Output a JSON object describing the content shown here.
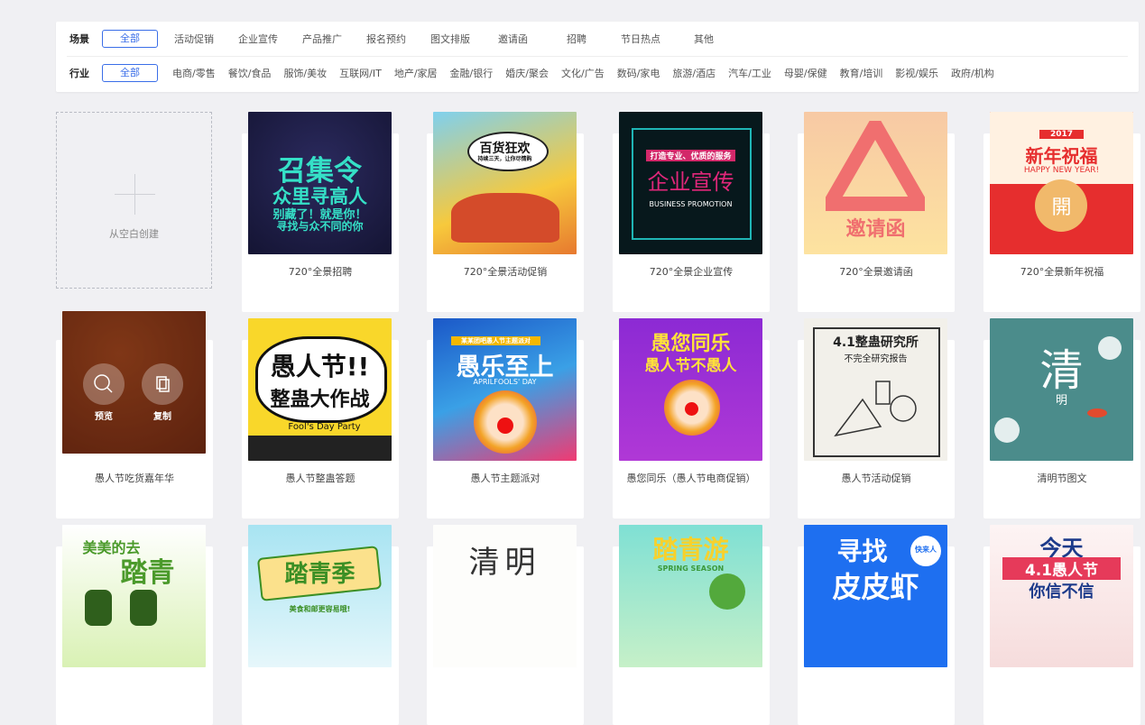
{
  "filters": {
    "scene_label": "场景",
    "scene_options": [
      "全部",
      "活动促销",
      "企业宣传",
      "产品推广",
      "报名预约",
      "图文排版",
      "邀请函",
      "招聘",
      "节日热点",
      "其他"
    ],
    "industry_label": "行业",
    "industry_options": [
      "全部",
      "电商/零售",
      "餐饮/食品",
      "服饰/美妆",
      "互联网/IT",
      "地产/家居",
      "金融/银行",
      "婚庆/聚会",
      "文化/广告",
      "数码/家电",
      "旅游/酒店",
      "汽车/工业",
      "母婴/保健",
      "教育/培训",
      "影视/娱乐",
      "政府/机构"
    ]
  },
  "blank": {
    "label": "从空白创建"
  },
  "overlay": {
    "preview": "预览",
    "copy": "复制"
  },
  "cards": [
    {
      "caption": "720°全景招聘",
      "t1": "召集令",
      "t2": "众里寻高人",
      "t3": "别藏了！就是你！",
      "t4": "寻找与众不同的你"
    },
    {
      "caption": "720°全景活动促销",
      "t1": "百货狂欢",
      "t2": "持续三天，让你尽情购"
    },
    {
      "caption": "720°全景企业宣传",
      "t1": "打造专业、优质的服务",
      "t2": "企业宣传",
      "t3": "BUSINESS PROMOTION"
    },
    {
      "caption": "720°全景邀请函",
      "t1": "邀请函"
    },
    {
      "caption": "720°全景新年祝福",
      "t1": "2017",
      "t2": "新年祝福",
      "t3": "HAPPY NEW YEAR!",
      "t4": "開"
    },
    {
      "caption": "愚人节吃货嘉年华"
    },
    {
      "caption": "愚人节整蛊答题",
      "t1": "愚人节!!",
      "t2": "整蛊大作战",
      "t3": "Fool's Day Party"
    },
    {
      "caption": "愚人节主题派对",
      "t1": "某某团吧愚人节主题派对",
      "t2": "愚乐至上",
      "t3": "APRILFOOLS' DAY"
    },
    {
      "caption": "愚您同乐（愚人节电商促销）",
      "t1": "愚您同乐",
      "t2": "愚人节不愚人"
    },
    {
      "caption": "愚人节活动促销",
      "t1": "4.1整蛊研究所",
      "t2": "不完全研究报告"
    },
    {
      "caption": "清明节图文",
      "t1": "清",
      "t2": "明"
    },
    {
      "t1": "美美的去",
      "t2": "踏青"
    },
    {
      "t1": "踏青季",
      "t2": "美食和邮更容易哦!"
    },
    {
      "t1": "清明"
    },
    {
      "t1": "踏青游",
      "t2": "SPRING SEASON"
    },
    {
      "t1": "寻找",
      "t2": "皮皮虾",
      "t3": "快来人"
    },
    {
      "t1": "今天",
      "t2": "4.1愚人节",
      "t3": "你信不信"
    }
  ]
}
